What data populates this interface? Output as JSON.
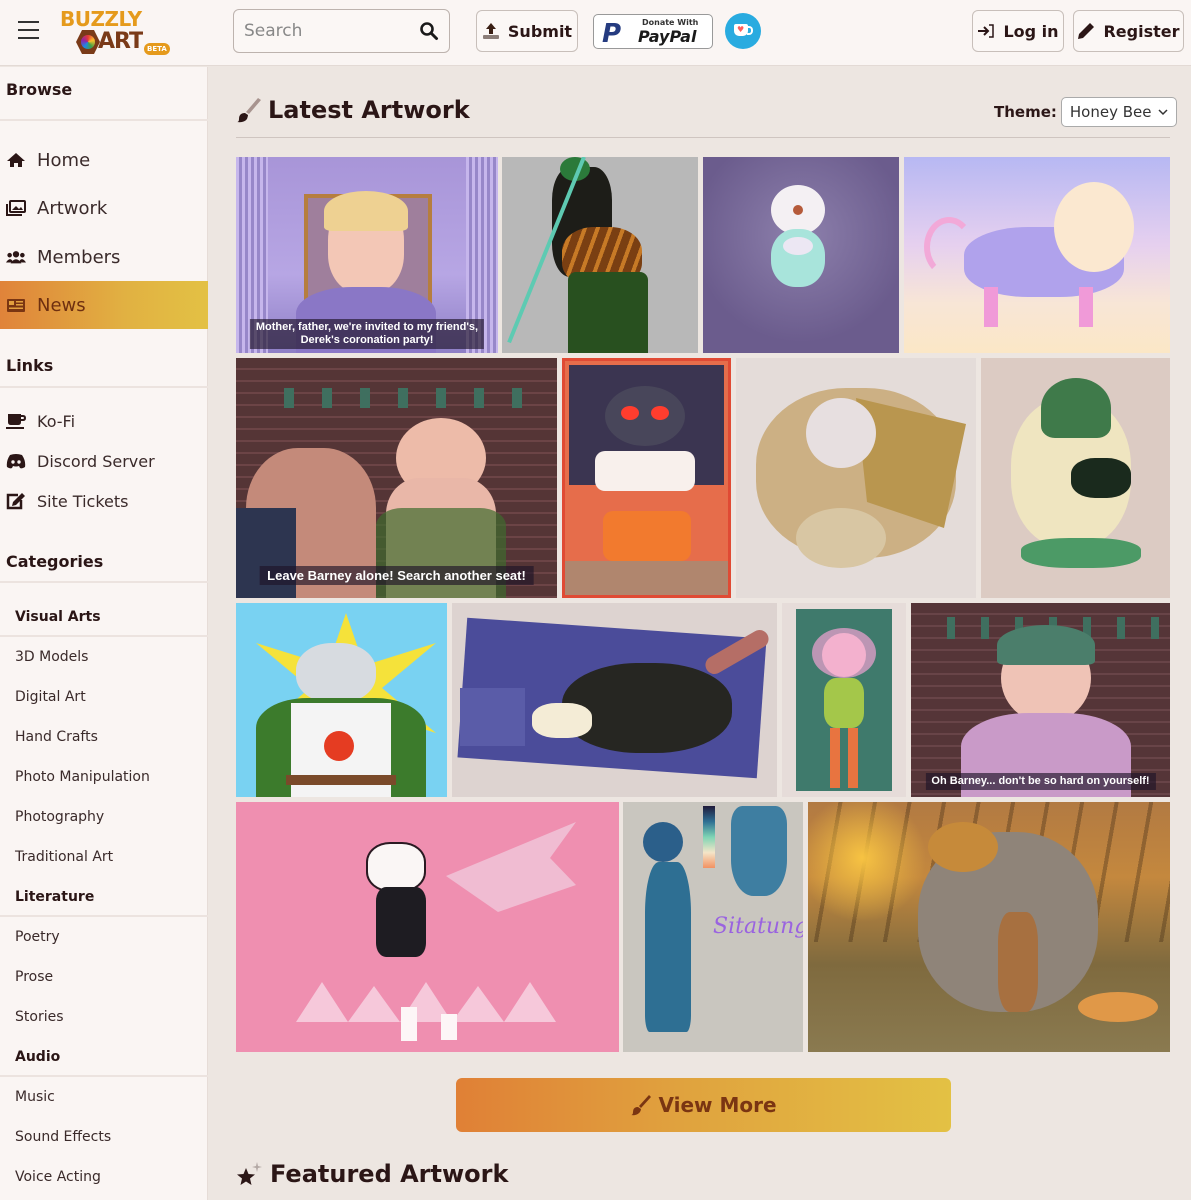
{
  "header": {
    "logo_top": "BUZZLY",
    "logo_bottom": "ART",
    "logo_badge": "BETA",
    "search_placeholder": "Search",
    "submit_label": "Submit",
    "paypal_top": "Donate With",
    "paypal_brand": "PayPal",
    "login_label": "Log in",
    "register_label": "Register"
  },
  "sidebar": {
    "browse_heading": "Browse",
    "browse_items": [
      {
        "label": "Home",
        "icon": "home-icon"
      },
      {
        "label": "Artwork",
        "icon": "images-icon"
      },
      {
        "label": "Members",
        "icon": "users-icon"
      },
      {
        "label": "News",
        "icon": "newspaper-icon",
        "active": true
      }
    ],
    "links_heading": "Links",
    "links": [
      {
        "label": "Ko-Fi",
        "icon": "coffee-icon"
      },
      {
        "label": "Discord Server",
        "icon": "discord-icon"
      },
      {
        "label": "Site Tickets",
        "icon": "edit-icon"
      }
    ],
    "categories_heading": "Categories",
    "categories": [
      {
        "name": "Visual Arts",
        "items": [
          "3D Models",
          "Digital Art",
          "Hand Crafts",
          "Photo Manipulation",
          "Photography",
          "Traditional Art"
        ]
      },
      {
        "name": "Literature",
        "items": [
          "Poetry",
          "Prose",
          "Stories"
        ]
      },
      {
        "name": "Audio",
        "items": [
          "Music",
          "Sound Effects",
          "Voice Acting"
        ]
      }
    ]
  },
  "main": {
    "latest_title": "Latest Artwork",
    "theme_label": "Theme:",
    "theme_value": "Honey Bee",
    "view_more_label": "View More",
    "featured_title": "Featured Artwork",
    "artworks": [
      {
        "caption": "Mother, father, we're invited to my friend's,\nDerek's coronation party!"
      },
      {
        "caption": ""
      },
      {
        "caption": ""
      },
      {
        "caption": ""
      },
      {
        "caption": "Leave Barney alone! Search another seat!"
      },
      {
        "caption": ""
      },
      {
        "caption": ""
      },
      {
        "caption": ""
      },
      {
        "caption": ""
      },
      {
        "caption": ""
      },
      {
        "caption": ""
      },
      {
        "caption": "Oh Barney... don't be so hard on yourself!"
      },
      {
        "caption": ""
      },
      {
        "caption": "Sitatunga"
      },
      {
        "caption": ""
      }
    ]
  },
  "colors": {
    "accent_start": "#e0833a",
    "accent_end": "#e3c144",
    "text_dark": "#2b1616",
    "page_bg": "#ede6e1",
    "panel_bg": "#faf5f3"
  }
}
